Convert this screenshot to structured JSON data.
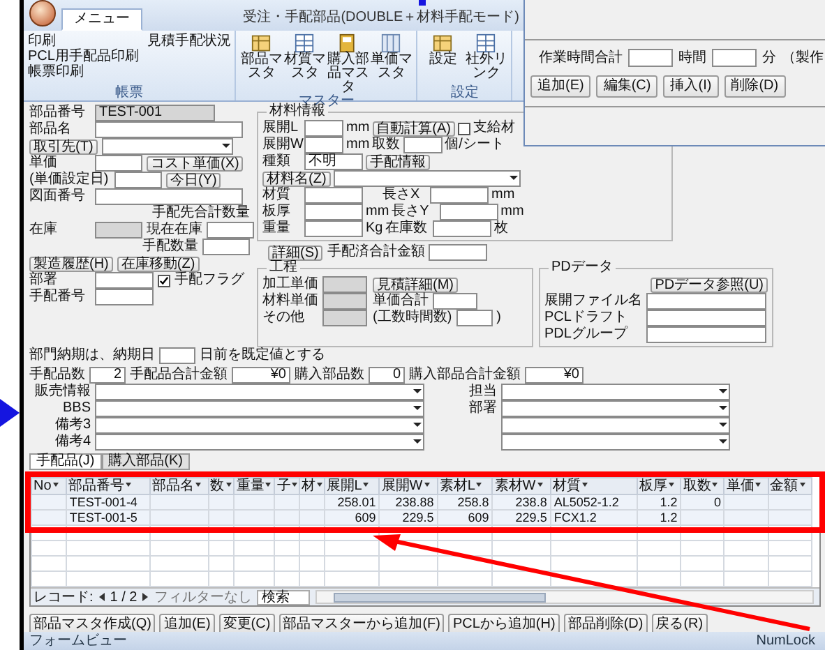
{
  "window": {
    "title": "受注・手配部品(DOUBLE＋材料手配モード)"
  },
  "ribbon": {
    "tabs": [
      {
        "label": "メニュー",
        "selected": true
      }
    ],
    "groups": [
      {
        "label": "帳票",
        "kind": "list",
        "items": [
          "印刷",
          "PCL用手配品印刷",
          "帳票印刷",
          "見積手配状況"
        ]
      },
      {
        "label": "マスター",
        "kind": "icons",
        "items": [
          "部品マスタ",
          "材質マスタ",
          "購入部品マスタ",
          "単価マスタ"
        ]
      },
      {
        "label": "設定",
        "kind": "icons",
        "items": [
          "設定",
          "社外リンク"
        ]
      }
    ]
  },
  "dialog": {
    "total_label": "作業時間合計",
    "hour_unit": "時間",
    "minute_unit": "分",
    "note": "（製作",
    "buttons": [
      "追加(E)",
      "編集(C)",
      "挿入(I)",
      "削除(D)"
    ]
  },
  "part": {
    "part_no": {
      "label": "部品番号",
      "value": "TEST-001"
    },
    "part_name": {
      "label": "部品名"
    },
    "supplier": {
      "button": "取引先(T)"
    },
    "unit_price": {
      "label": "単価",
      "button": "コスト単価(X)"
    },
    "price_date": {
      "label": "(単価設定日)",
      "button": "今日(Y)"
    },
    "drawing_no": {
      "label": "図面番号"
    },
    "order_total_caption": "手配先合計数量",
    "stock": {
      "label": "在庫"
    },
    "current_stock": {
      "label": "現在在庫"
    },
    "history_buttons": [
      "製造履歴(H)",
      "在庫移動(Z)"
    ],
    "order_qty": {
      "label": "手配数量"
    },
    "dept": {
      "label": "部署"
    },
    "order_flag": {
      "label": "手配フラグ",
      "checked": true
    },
    "order_no": {
      "label": "手配番号"
    },
    "lead_time": {
      "prefix": "部門納期は、納期日",
      "suffix": "日前を既定値とする"
    }
  },
  "material": {
    "title": "材料情報",
    "unfold_l": {
      "label": "展開L",
      "unit": "mm",
      "button": "自動計算(A)"
    },
    "supplied": {
      "label": "支給材",
      "checked": false
    },
    "unfold_w": {
      "label": "展開W",
      "unit": "mm"
    },
    "yield": {
      "label": "取数",
      "unit": "個/シート"
    },
    "type": {
      "label": "種類",
      "value": "不明",
      "button": "手配情報"
    },
    "name": {
      "button": "材料名(Z)"
    },
    "grade": {
      "label": "材質"
    },
    "length_x": {
      "label": "長さX",
      "unit": "mm"
    },
    "thickness": {
      "label": "板厚",
      "unit": "mm"
    },
    "length_y": {
      "label": "長さY",
      "unit": "mm"
    },
    "weight": {
      "label": "重量",
      "unit": "Kg"
    },
    "stock_count": {
      "label": "在庫数",
      "unit": "枚"
    }
  },
  "detail": {
    "button": "詳細(S)",
    "total_label": "手配済合計金額"
  },
  "process": {
    "title": "工程",
    "rows": [
      "加工単価",
      "材料単価",
      "その他"
    ],
    "sum_label": "単価合計",
    "estimate_button": "見積詳細(M)",
    "hours_label": "(工数時間数)",
    "hours_close": ")"
  },
  "pd": {
    "title": "PDデータ",
    "button": "PDデータ参照(U)",
    "fields": [
      "展開ファイル名",
      "PCLドラフト",
      "PDLグループ"
    ]
  },
  "counts": [
    {
      "label": "手配品数",
      "value": "2"
    },
    {
      "label": "手配品合計金額",
      "value": "¥0"
    },
    {
      "label": "購入部品数",
      "value": "0"
    },
    {
      "label": "購入部品合計金額",
      "value": "¥0"
    }
  ],
  "combos": [
    {
      "label": "販売情報"
    },
    {
      "label": "BBS"
    },
    {
      "label": "備考3"
    },
    {
      "label": "備考4"
    }
  ],
  "side_combos": [
    {
      "kind": "labeled",
      "label": "担当"
    },
    {
      "kind": "labeled",
      "label": "部署"
    },
    {
      "kind": "plain"
    },
    {
      "kind": "plain"
    }
  ],
  "subform_tabs": [
    {
      "label": "手配品(J)",
      "selected": true
    },
    {
      "label": "購入部品(K)",
      "selected": false
    }
  ],
  "grid": {
    "columns": [
      "No",
      "部品番号",
      "部品名",
      "数",
      "重量",
      "子",
      "材",
      "展開L",
      "展開W",
      "素材L",
      "素材W",
      "材質",
      "板厚",
      "取数",
      "単価",
      "金額"
    ],
    "rows": [
      {
        "cells": [
          null,
          "TEST-001-4",
          null,
          null,
          null,
          null,
          null,
          "258.01",
          "238.88",
          "258.8",
          "238.8",
          "AL5052-1.2",
          "1.2",
          "0",
          null,
          null
        ]
      },
      {
        "cells": [
          null,
          "TEST-001-5",
          null,
          null,
          null,
          null,
          null,
          "609",
          "229.5",
          "609",
          "229.5",
          "FCX1.2",
          "1.2",
          null,
          null,
          null
        ]
      }
    ]
  },
  "navigator": {
    "label": "レコード:",
    "position": "1 / 2",
    "filter": "フィルターなし",
    "search": "検索"
  },
  "buttons": [
    "部品マスタ作成(Q)",
    "追加(E)",
    "変更(C)",
    "部品マスターから追加(F)",
    "PCLから追加(H)",
    "部品削除(D)",
    "戻る(R)"
  ],
  "status_bar": {
    "left": "フォームビュー",
    "right": "NumLock"
  }
}
